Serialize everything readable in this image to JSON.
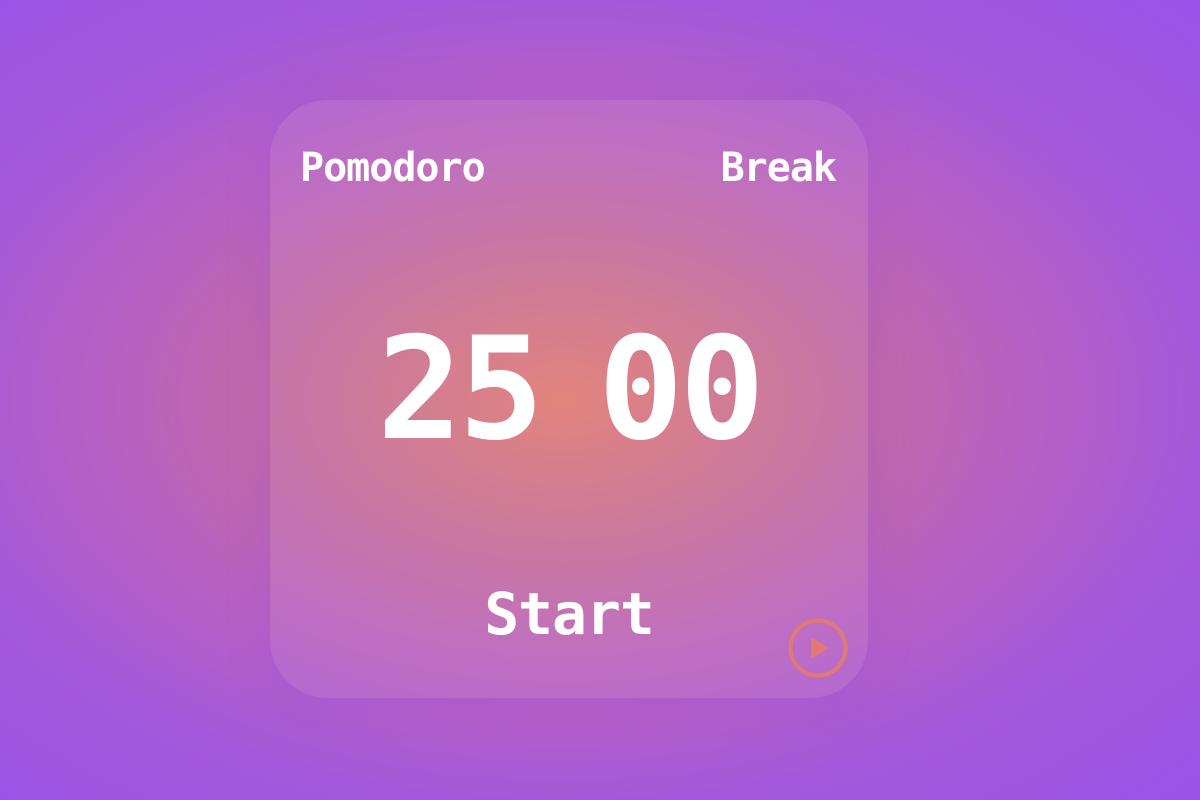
{
  "tabs": {
    "pomodoro_label": "Pomodoro",
    "break_label": "Break"
  },
  "timer": {
    "minutes": "25",
    "seconds": "00"
  },
  "controls": {
    "start_label": "Start",
    "play_icon": "play-circle-icon"
  },
  "colors": {
    "text": "#ffffff",
    "accent": "#e07a72",
    "background_outer": "#9a52e8",
    "background_center": "#e07a72"
  }
}
